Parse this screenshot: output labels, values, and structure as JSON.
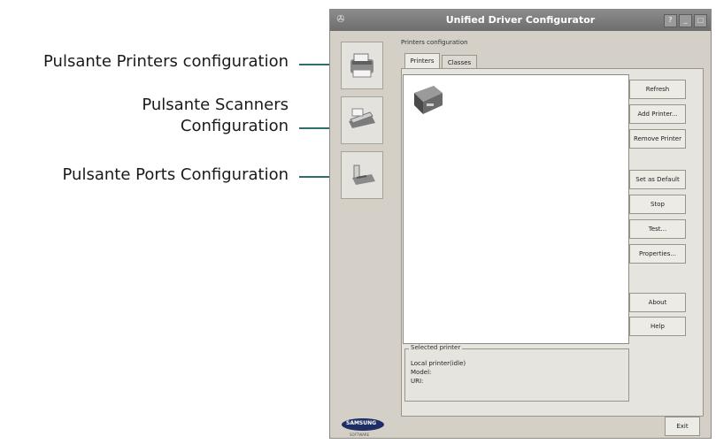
{
  "callouts": [
    {
      "line1": "Pulsante Printers configuration",
      "line2": ""
    },
    {
      "line1": "Pulsante Scanners",
      "line2": "Configuration"
    },
    {
      "line1": "Pulsante Ports Configuration",
      "line2": ""
    }
  ],
  "window": {
    "title": "Unified Driver Configurator",
    "title_icon": "printer-small-icon",
    "title_buttons": [
      "help-icon",
      "minimize-icon",
      "close-icon"
    ]
  },
  "sidebar": {
    "items": [
      {
        "name": "printers-configuration",
        "icon": "printer-icon"
      },
      {
        "name": "scanners-configuration",
        "icon": "scanner-icon"
      },
      {
        "name": "ports-configuration",
        "icon": "port-icon"
      }
    ]
  },
  "main": {
    "group_label": "Printers configuration",
    "tabs": [
      {
        "label": "Printers",
        "active": true
      },
      {
        "label": "Classes",
        "active": false
      }
    ],
    "buttons": {
      "refresh": "Refresh",
      "add_printer": "Add Printer...",
      "remove_printer": "Remove Printer",
      "set_default": "Set as Default",
      "stop": "Stop",
      "test": "Test...",
      "properties": "Properties...",
      "about": "About",
      "help": "Help"
    },
    "selected_printer": {
      "label": "Selected printer",
      "line1": "Local printer(idle)",
      "line2": "Model:",
      "line3": "URI:"
    },
    "exit_label": "Exit"
  },
  "logo": {
    "text": "SAMSUNG",
    "sub": "SOFTWARE"
  },
  "colors": {
    "accent": "#1f8a86",
    "window_bg": "#d4d0c8",
    "title_bg": "#7a7a7a"
  }
}
